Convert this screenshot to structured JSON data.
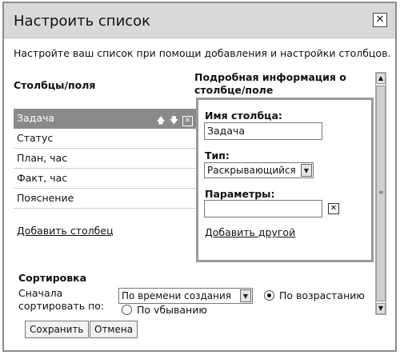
{
  "dialog": {
    "title": "Настроить список",
    "close_glyph": "✕",
    "intro": "Настройте ваш список при помощи добавления и настройки столбцов."
  },
  "columns": {
    "heading": "Столбцы/поля",
    "items": [
      {
        "label": "Задача",
        "selected": true
      },
      {
        "label": "Статус"
      },
      {
        "label": "План, час"
      },
      {
        "label": "Факт, час"
      },
      {
        "label": "Пояснение"
      }
    ],
    "up_glyph": "🡅",
    "down_glyph": "🡇",
    "remove_glyph": "✕",
    "add_label": "Добавить столбец"
  },
  "details": {
    "heading": "Подробная информация о столбце/поле",
    "name_label": "Имя столбца:",
    "name_value": "Задача",
    "type_label": "Тип:",
    "type_value": "Раскрывающийся",
    "params_label": "Параметры:",
    "params_value": "",
    "remove_glyph": "✕",
    "add_other": "Добавить другой"
  },
  "sorting": {
    "heading": "Сортировка",
    "sort_by_label": "Сначала сортировать по:",
    "sort_by_value": "По времени создания",
    "asc_label": "По возрастанию",
    "asc_checked": true,
    "desc_label": "По убыванию",
    "desc_checked": false
  },
  "buttons": {
    "save": "Сохранить",
    "cancel": "Отмена"
  },
  "icons": {
    "dropdown": "chevron-down-icon",
    "close": "close-icon",
    "arrow_up": "arrow-up-icon",
    "arrow_down": "arrow-down-icon"
  }
}
